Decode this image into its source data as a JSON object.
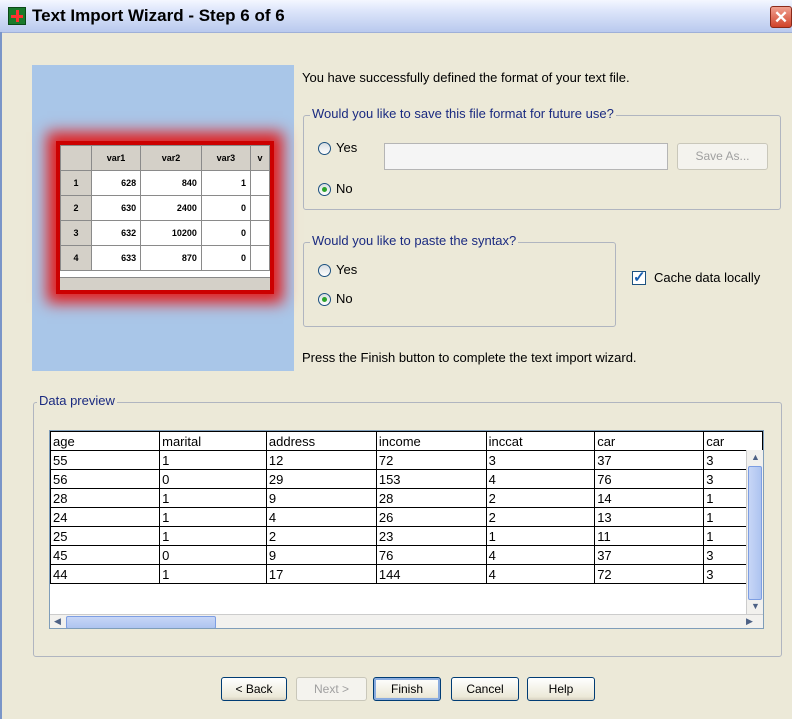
{
  "window": {
    "title": "Text Import Wizard - Step 6 of 6",
    "close_glyph": "✕"
  },
  "preview_image": {
    "headers": [
      "",
      "var1",
      "var2",
      "var3",
      "v"
    ],
    "rows": [
      [
        "1",
        "628",
        "840",
        "1",
        ""
      ],
      [
        "2",
        "630",
        "2400",
        "0",
        ""
      ],
      [
        "3",
        "632",
        "10200",
        "0",
        ""
      ],
      [
        "4",
        "633",
        "870",
        "0",
        ""
      ]
    ]
  },
  "intro_text": "You have successfully defined the format of your text file.",
  "save_format": {
    "legend": "Would you like to save this file format for future use?",
    "yes_label": "Yes",
    "no_label": "No",
    "selected": "No",
    "filename_value": "",
    "save_as_label": "Save As..."
  },
  "paste_syntax": {
    "legend": "Would you like to paste the syntax?",
    "yes_label": "Yes",
    "no_label": "No",
    "selected": "No"
  },
  "cache": {
    "label": "Cache data locally",
    "checked": true
  },
  "finish_text": "Press the Finish button to complete the text import wizard.",
  "data_preview": {
    "legend": "Data preview",
    "columns": [
      "age",
      "marital",
      "address",
      "income",
      "inccat",
      "car",
      "car"
    ],
    "rows": [
      [
        "55",
        "1",
        "12",
        "72",
        "3",
        "37",
        "3"
      ],
      [
        "56",
        "0",
        "29",
        "153",
        "4",
        "76",
        "3"
      ],
      [
        "28",
        "1",
        "9",
        "28",
        "2",
        "14",
        "1"
      ],
      [
        "24",
        "1",
        "4",
        "26",
        "2",
        "13",
        "1"
      ],
      [
        "25",
        "1",
        "2",
        "23",
        "1",
        "11",
        "1"
      ],
      [
        "45",
        "0",
        "9",
        "76",
        "4",
        "37",
        "3"
      ],
      [
        "44",
        "1",
        "17",
        "144",
        "4",
        "72",
        "3"
      ]
    ]
  },
  "buttons": {
    "back": "< Back",
    "next": "Next >",
    "finish": "Finish",
    "cancel": "Cancel",
    "help": "Help"
  },
  "colors": {
    "radio_selected": "#2aa32a",
    "title_bar": "#c9d6f3",
    "close_button": "#d0432a",
    "preview_highlight": "#e02020"
  }
}
